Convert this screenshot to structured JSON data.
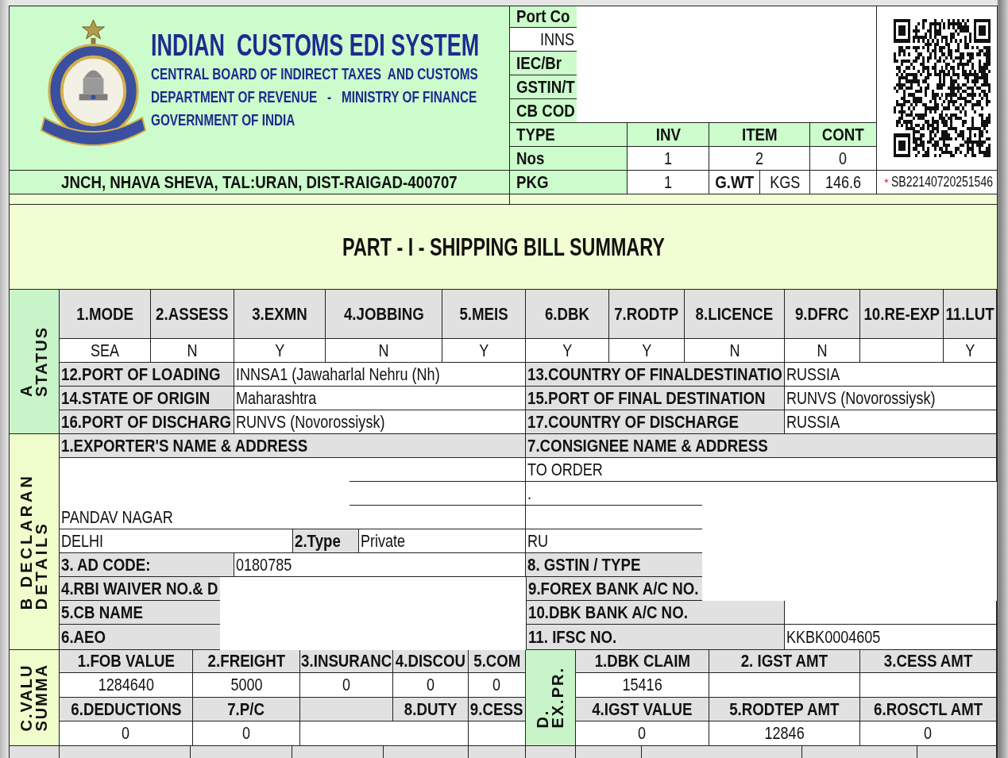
{
  "header": {
    "title": "INDIAN  CUSTOMS EDI SYSTEM",
    "subtitle_lines": [
      "CENTRAL BOARD OF INDIRECT TAXES  AND CUSTOMS",
      "DEPARTMENT OF REVENUE   -   MINISTRY OF FINANCE",
      "GOVERNMENT OF INDIA"
    ],
    "address": "JNCH, NHAVA SHEVA, TAL:URAN, DIST-RAIGAD-400707",
    "info_rows": [
      {
        "kind": "label",
        "text": "Port Co"
      },
      {
        "kind": "value",
        "text": "INNS"
      },
      {
        "kind": "label",
        "text": "IEC/Br"
      },
      {
        "kind": "label",
        "text": "GSTIN/T"
      },
      {
        "kind": "label",
        "text": "CB COD"
      }
    ],
    "counts_table": {
      "columns": [
        "TYPE",
        "INV",
        "ITEM",
        "CONT"
      ],
      "nos_row": {
        "label": "Nos",
        "inv": "1",
        "item": "2",
        "cont": "0"
      },
      "pkg_row": {
        "label": "PKG",
        "inv": "1",
        "weight_label": "G.WT",
        "weight_unit": "KGS",
        "weight_value": "146.6"
      }
    },
    "sb_number": {
      "marker": "*",
      "number": "SB22140720251546"
    }
  },
  "title": "PART - I - SHIPPING BILL SUMMARY",
  "status": {
    "label_lines": [
      "A",
      "STATUS"
    ],
    "indicators": [
      {
        "label": "1.MODE",
        "value": "SEA"
      },
      {
        "label": "2.ASSESS",
        "value": "N"
      },
      {
        "label": "3.EXMN",
        "value": "Y"
      },
      {
        "label": "4.JOBBING",
        "value": "N"
      },
      {
        "label": "5.MEIS",
        "value": "Y"
      },
      {
        "label": "6.DBK",
        "value": "Y"
      },
      {
        "label": "7.RODTP",
        "value": "Y"
      },
      {
        "label": "8.LICENCE",
        "value": "N"
      },
      {
        "label": "9.DFRC",
        "value": "N"
      },
      {
        "label": "10.RE-EXP"
      },
      {
        "label": "11.LUT",
        "value": "Y"
      }
    ],
    "places": [
      {
        "label": "12.PORT OF LOADING",
        "value": "INNSA1 (Jawaharlal Nehru (Nh)"
      },
      {
        "label": "13.COUNTRY OF FINALDESTINATIO",
        "value": "RUSSIA"
      },
      {
        "label": "14.STATE OF ORIGIN",
        "value": "Maharashtra"
      },
      {
        "label": "15.PORT OF FINAL DESTINATION",
        "value": "RUNVS (Novorossiysk)"
      },
      {
        "label": "16.PORT OF DISCHARG",
        "value": "RUNVS (Novorossiysk)"
      },
      {
        "label": "17.COUNTRY OF DISCHARGE",
        "value": "RUSSIA"
      }
    ]
  },
  "declaration": {
    "label_lines": [
      "B DECLARAN",
      "DETAILS"
    ],
    "exporter": {
      "heading": "1.EXPORTER'S NAME & ADDRESS",
      "address_line_3": "PANDAV NAGAR",
      "city": "DELHI",
      "type_label": "2.Type",
      "type_value": "Private"
    },
    "consignee": {
      "heading": "7.CONSIGNEE NAME & ADDRESS",
      "name": "TO ORDER",
      "address_line_1": ".",
      "country": "RU"
    },
    "left_fields": [
      {
        "label": "3. AD CODE:",
        "value": "0180785"
      },
      {
        "label": "4.RBI WAIVER NO.& D"
      },
      {
        "label": "5.CB NAME"
      },
      {
        "label": "6.AEO"
      }
    ],
    "right_fields": [
      {
        "label": "8. GSTIN / TYPE"
      },
      {
        "label": "9.FOREX BANK A/C NO."
      },
      {
        "label": "10.DBK BANK A/C NO."
      },
      {
        "label": "11. IFSC NO.",
        "value": "KKBK0004605"
      }
    ]
  },
  "valuation": {
    "label_lines": [
      "C.VALU",
      "SUMMA"
    ],
    "fields": [
      {
        "label": "1.FOB VALUE",
        "value": "1284640"
      },
      {
        "label": "2.FREIGHT",
        "value": "5000"
      },
      {
        "label": "3.INSURANC",
        "value": "0"
      },
      {
        "label": "4.DISCOU",
        "value": "0"
      },
      {
        "label": "5.COM",
        "value": "0"
      }
    ],
    "fields_2": [
      {
        "label": "6.DEDUCTIONS",
        "value": "0"
      },
      {
        "label": "7.P/C",
        "value": "0"
      },
      {
        "label": "8.DUTY"
      },
      {
        "label": "9.CESS"
      }
    ]
  },
  "export_promotion": {
    "label_lines": [
      "D.",
      "EX.PR."
    ],
    "fields": [
      {
        "label": "1.DBK CLAIM",
        "value": "15416"
      },
      {
        "label": "2. IGST AMT"
      },
      {
        "label": "3.CESS AMT"
      }
    ],
    "fields_2": [
      {
        "label": "4.IGST VALUE",
        "value": "0"
      },
      {
        "label": "5.RODTEP AMT",
        "value": "12846"
      },
      {
        "label": "6.ROSCTL AMT",
        "value": "0"
      }
    ]
  }
}
